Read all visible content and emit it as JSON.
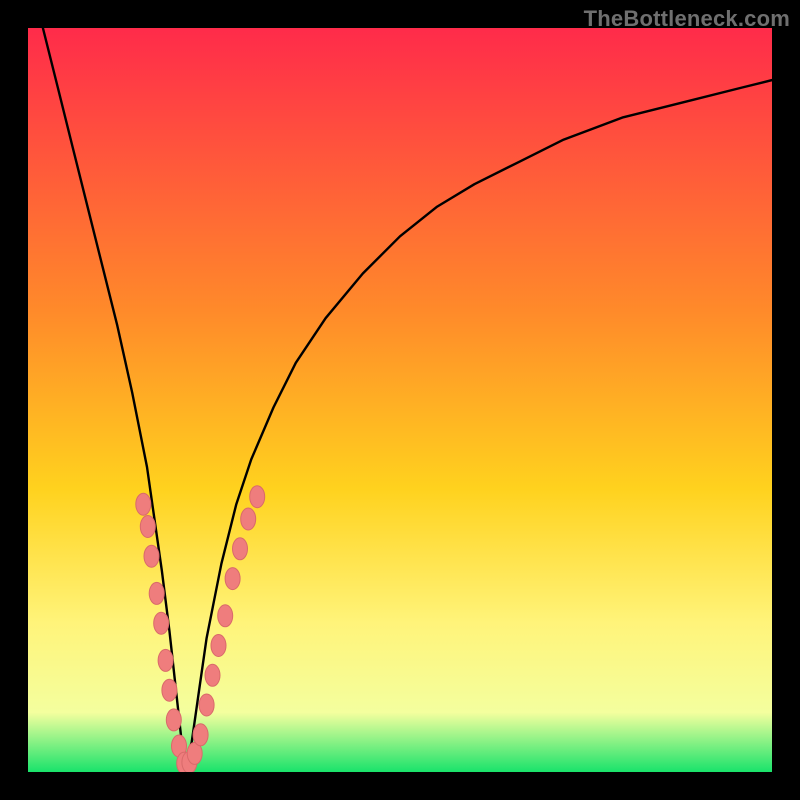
{
  "watermark": "TheBottleneck.com",
  "colors": {
    "frame": "#000000",
    "grad_top": "#ff2b4a",
    "grad_mid1": "#ff6a2c",
    "grad_mid2": "#ffd21e",
    "grad_mid3": "#fff47a",
    "grad_mid4": "#f4ff9e",
    "grad_bottom": "#19e36b",
    "curve": "#000000",
    "dot_fill": "#ef7d7d",
    "dot_stroke": "#d96a6a"
  },
  "chart_data": {
    "type": "line",
    "title": "",
    "xlabel": "",
    "ylabel": "",
    "xlim": [
      0,
      100
    ],
    "ylim": [
      0,
      100
    ],
    "notes": "V-shaped bottleneck curve. x is a normalized component-ratio axis (0–100), y is bottleneck % (0 at bottom = no bottleneck, 100 at top). Minimum near x≈21. Salmon dots mark sampled configurations clustered around the trough.",
    "series": [
      {
        "name": "bottleneck-curve",
        "x": [
          2,
          4,
          6,
          8,
          10,
          12,
          14,
          16,
          18,
          19,
          20,
          21,
          22,
          23,
          24,
          26,
          28,
          30,
          33,
          36,
          40,
          45,
          50,
          55,
          60,
          66,
          72,
          80,
          88,
          96,
          100
        ],
        "y": [
          100,
          92,
          84,
          76,
          68,
          60,
          51,
          41,
          27,
          19,
          10,
          1,
          4,
          11,
          18,
          28,
          36,
          42,
          49,
          55,
          61,
          67,
          72,
          76,
          79,
          82,
          85,
          88,
          90,
          92,
          93
        ]
      }
    ],
    "scatter": [
      {
        "name": "sample-points",
        "points": [
          {
            "x": 15.5,
            "y": 36
          },
          {
            "x": 16.1,
            "y": 33
          },
          {
            "x": 16.6,
            "y": 29
          },
          {
            "x": 17.3,
            "y": 24
          },
          {
            "x": 17.9,
            "y": 20
          },
          {
            "x": 18.5,
            "y": 15
          },
          {
            "x": 19.0,
            "y": 11
          },
          {
            "x": 19.6,
            "y": 7
          },
          {
            "x": 20.3,
            "y": 3.5
          },
          {
            "x": 21.0,
            "y": 1.2
          },
          {
            "x": 21.7,
            "y": 1.3
          },
          {
            "x": 22.4,
            "y": 2.5
          },
          {
            "x": 23.2,
            "y": 5
          },
          {
            "x": 24.0,
            "y": 9
          },
          {
            "x": 24.8,
            "y": 13
          },
          {
            "x": 25.6,
            "y": 17
          },
          {
            "x": 26.5,
            "y": 21
          },
          {
            "x": 27.5,
            "y": 26
          },
          {
            "x": 28.5,
            "y": 30
          },
          {
            "x": 29.6,
            "y": 34
          },
          {
            "x": 30.8,
            "y": 37
          }
        ]
      }
    ]
  }
}
